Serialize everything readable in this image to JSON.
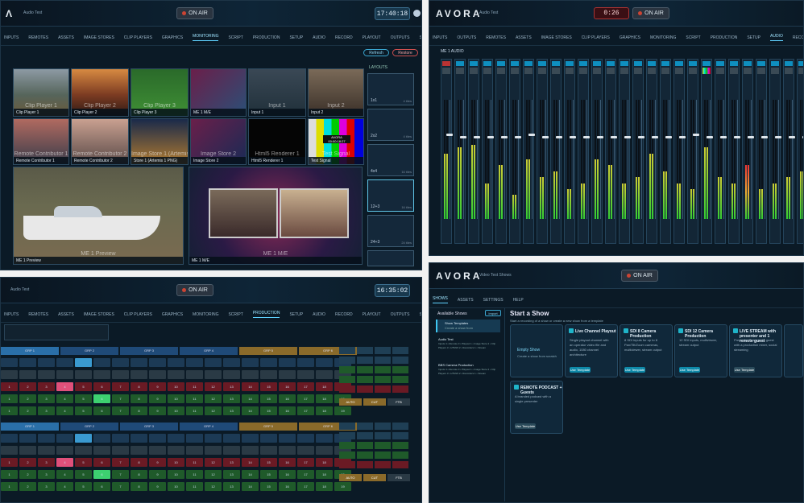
{
  "panel1": {
    "logo": "Λ",
    "subtitle": "Audio Test",
    "on_air": "ON AIR",
    "clock": "17:40:18",
    "nav": [
      "INPUTS",
      "REMOTES",
      "ASSETS",
      "IMAGE STORES",
      "CLIP PLAYERS",
      "GRAPHICS",
      "MONITORING",
      "SCRIPT",
      "PRODUCTION",
      "SETUP",
      "AUDIO",
      "RECORD",
      "PLAYOUT",
      "OUTPUTS",
      "SETTINGS",
      "HELP"
    ],
    "active_nav": "MONITORING",
    "buttons": [
      "Refresh",
      "Restore"
    ],
    "layouts_title": "LAYOUTS",
    "tiles": [
      {
        "big": "Clip Player 1",
        "label": "Clip Player 1"
      },
      {
        "big": "Clip Player 2",
        "label": "Clip Player 2"
      },
      {
        "big": "Clip Player 3",
        "label": "Clip Player 3"
      },
      {
        "big": "",
        "label": "ME 1 M/E"
      },
      {
        "big": "Input 1",
        "label": "Input 1"
      },
      {
        "big": "Input 2",
        "label": "Input 2"
      },
      {
        "big": "Remote Contributor 1",
        "label": "Remote Contributor 1"
      },
      {
        "big": "Remote Contributor 2",
        "label": "Remote Contributor 2"
      },
      {
        "big": "Image Store 1 (Artemis 1 PNG)",
        "label": "Store 1 (Artemis 1 PNG)"
      },
      {
        "big": "Image Store 2",
        "label": "Image Store 2"
      },
      {
        "big": "Html5 Renderer 1",
        "label": "Html5 Renderer 1"
      },
      {
        "big": "Test Signal",
        "label": "Test Signal"
      }
    ],
    "large_tiles": [
      {
        "big": "ME 1 Preview",
        "label": "ME 1 Preview"
      },
      {
        "big": "ME 1 M/E",
        "label": "ME 1 M/E"
      }
    ],
    "test_signal_text": "AVORA 00:00:18:27",
    "layout_options": [
      {
        "name": "1x1",
        "count": "4 tiles"
      },
      {
        "name": "2x2",
        "count": "4 tiles"
      },
      {
        "name": "4x4",
        "count": "16 tiles"
      },
      {
        "name": "12+3",
        "count": "16 tiles"
      },
      {
        "name": "24+3",
        "count": "24 tiles"
      },
      {
        "name": "",
        "count": ""
      }
    ]
  },
  "panel2": {
    "logo": "AVORA",
    "subtitle": "Audio Test",
    "timer": "0:26",
    "on_air": "ON AIR",
    "nav": [
      "INPUTS",
      "OUTPUTS",
      "REMOTES",
      "ASSETS",
      "IMAGE STORES",
      "CLIP PLAYERS",
      "GRAPHICS",
      "MONITORING",
      "SCRIPT",
      "PRODUCTION",
      "SETUP",
      "AUDIO",
      "RECORD",
      "PLAYOUT",
      "OUTPUTS"
    ],
    "active_nav": "AUDIO",
    "section_title": "ME 1 AUDIO",
    "strip_count": 27
  },
  "panel3": {
    "logo": "Λ",
    "subtitle": "Audio Test",
    "on_air": "ON AIR",
    "clock": "16:35:02",
    "nav": [
      "INPUTS",
      "REMOTES",
      "ASSETS",
      "IMAGE STORES",
      "CLIP PLAYERS",
      "GRAPHICS",
      "MONITORING",
      "SCRIPT",
      "PRODUCTION",
      "SETUP",
      "AUDIO",
      "RECORD",
      "PLAYOUT",
      "OUTPUTS",
      "SETTINGS",
      "HELP"
    ],
    "active_nav": "PRODUCTION",
    "groups_top": [
      "GRP 1",
      "GRP 2",
      "GRP 3",
      "GRP 4",
      "GRP 5",
      "GRP 6"
    ],
    "numbers": [
      "1",
      "2",
      "3",
      "4",
      "5",
      "6",
      "7",
      "8",
      "9",
      "10",
      "11",
      "12",
      "13",
      "14",
      "15",
      "16",
      "17",
      "18",
      "19",
      "20"
    ],
    "side_labels": [
      "AUTO",
      "CUT",
      "FTB"
    ]
  },
  "panel4": {
    "logo": "AVORA",
    "subtitle": "Video Test Shows",
    "on_air": "ON AIR",
    "nav": [
      "SHOWS",
      "ASSETS",
      "SETTINGS",
      "HELP"
    ],
    "active_nav": "SHOWS",
    "sidebar_title": "Available Shows",
    "sidebar_button": "Import",
    "sidebar_items": [
      {
        "title": "Show Templates",
        "sub": "Create a show from"
      },
      {
        "title": "Audio Test",
        "sub": "Inputs 4 • Remote 3 • Playout 1 • Image Store 2 • Clip Players 3 • HTML5 2 • Recorders 1 • Stream"
      },
      {
        "title": "BBS Camera Production",
        "sub": "Inputs 4 • Remote 3 • Playout 1 • Image Store 2 • Clip Players 3 • HTML5 2 • Recorders 1 • Stream"
      }
    ],
    "main_title": "Start a Show",
    "main_sub": "Start a recording of a show or create a new show from a template",
    "empty_card": {
      "title": "Empty Show",
      "sub": "Create a show from scratch"
    },
    "cards": [
      {
        "title": "Live Channel Playout",
        "desc": "Single playout channel with an operator video file and audio, 1080 channel architecture",
        "button": "Use Template"
      },
      {
        "title": "SDI 8 Camera Production",
        "desc": "8 SDI inputs for up to 8 Pan/Tilt/Zoom cameras, multiviewer, stream output",
        "button": "Use Template"
      },
      {
        "title": "SDI 12 Camera Production",
        "desc": "12 SDI inputs, multiviewer, stream output",
        "button": "Use Template"
      },
      {
        "title": "LIVE STREAM with presenter and 1 remote guest",
        "desc": "Presenter and remote guest with a production mixer, social streaming",
        "button": "Use Template"
      },
      {
        "title": "REMOTE PODCAST + Guests",
        "desc": "A branded podcast with a single presenter",
        "button": "Use Template"
      }
    ]
  }
}
